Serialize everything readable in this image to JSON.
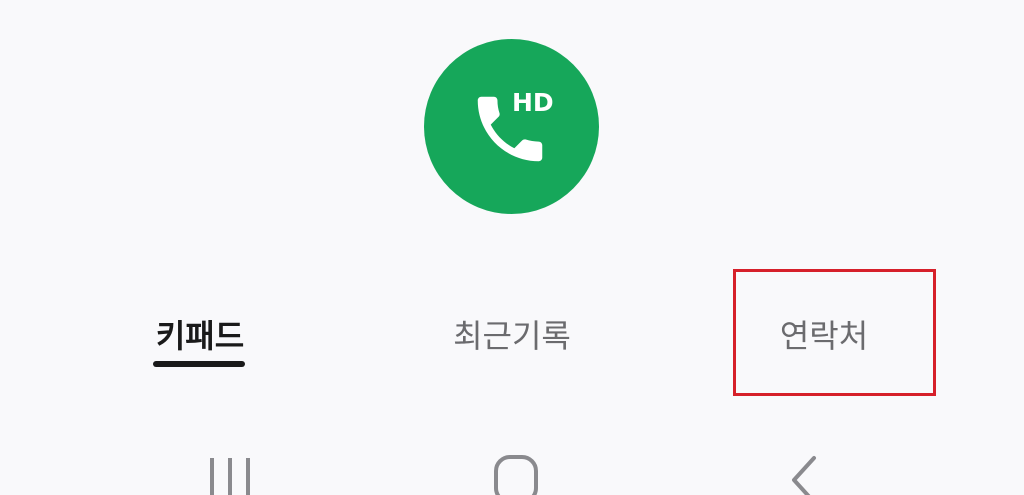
{
  "call_button": {
    "badge": "HD",
    "icon": "phone-icon",
    "color": "#16a75a"
  },
  "tabs": [
    {
      "label": "키패드",
      "active": true
    },
    {
      "label": "최근기록",
      "active": false
    },
    {
      "label": "연락처",
      "active": false
    }
  ],
  "highlight": {
    "target": "tab-contacts",
    "color": "#d6202a"
  },
  "nav_bar": {
    "buttons": [
      "recent-apps-icon",
      "home-icon",
      "back-icon"
    ]
  }
}
